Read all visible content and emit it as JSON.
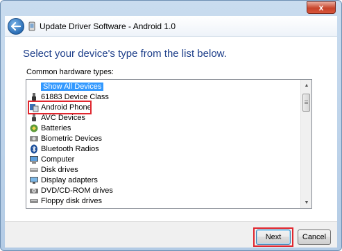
{
  "window": {
    "title": "Update Driver Software - Android 1.0",
    "close_glyph": "x"
  },
  "content": {
    "heading": "Select your device's type from the list below.",
    "subheading": "Common hardware types:"
  },
  "list": {
    "items": [
      {
        "label": "Show All Devices",
        "icon": "none",
        "selected": true
      },
      {
        "label": "61883 Device Class",
        "icon": "usb-plug-icon"
      },
      {
        "label": "Android Phone",
        "icon": "phone-device-icon",
        "highlighted": true
      },
      {
        "label": "AVC Devices",
        "icon": "avc-plug-icon"
      },
      {
        "label": "Batteries",
        "icon": "battery-icon"
      },
      {
        "label": "Biometric Devices",
        "icon": "biometric-icon"
      },
      {
        "label": "Bluetooth Radios",
        "icon": "bluetooth-icon"
      },
      {
        "label": "Computer",
        "icon": "computer-icon"
      },
      {
        "label": "Disk drives",
        "icon": "disk-drive-icon"
      },
      {
        "label": "Display adapters",
        "icon": "display-adapter-icon"
      },
      {
        "label": "DVD/CD-ROM drives",
        "icon": "dvd-drive-icon"
      },
      {
        "label": "Floppy disk drives",
        "icon": "floppy-icon"
      }
    ]
  },
  "buttons": {
    "next": "Next",
    "cancel": "Cancel"
  },
  "colors": {
    "heading": "#1e3f8a",
    "selection": "#3399ff",
    "highlight_box": "#e0262e"
  }
}
